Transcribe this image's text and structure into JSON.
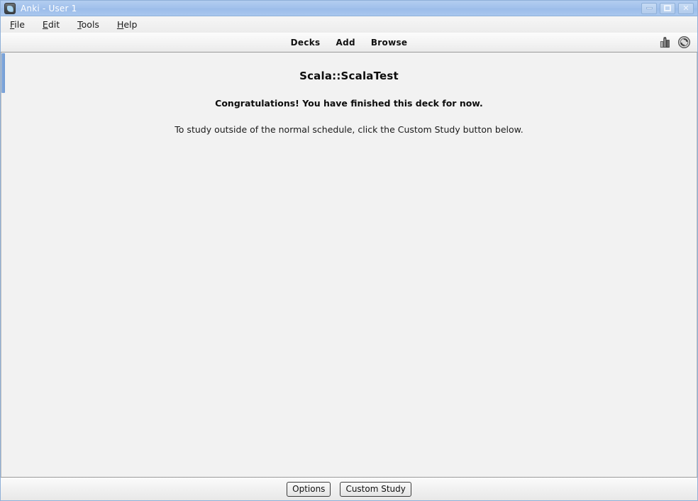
{
  "window": {
    "title": "Anki - User 1",
    "icon": "anki-app-icon",
    "controls": [
      {
        "name": "minimize",
        "glyph": "minimize-icon"
      },
      {
        "name": "maximize",
        "glyph": "maximize-icon"
      },
      {
        "name": "close",
        "glyph": "close-icon",
        "label": "✕"
      }
    ]
  },
  "menubar": {
    "items": [
      {
        "mnemonic": "F",
        "rest": "ile"
      },
      {
        "mnemonic": "E",
        "rest": "dit"
      },
      {
        "mnemonic": "T",
        "rest": "ools"
      },
      {
        "mnemonic": "H",
        "rest": "elp"
      }
    ]
  },
  "toolbar": {
    "links": [
      {
        "label": "Decks",
        "name": "decks"
      },
      {
        "label": "Add",
        "name": "add"
      },
      {
        "label": "Browse",
        "name": "browse"
      }
    ],
    "icons": [
      {
        "name": "stats-bar-chart-icon"
      },
      {
        "name": "sync-icon"
      }
    ]
  },
  "content": {
    "deck_title": "Scala::ScalaTest",
    "congrats": "Congratulations! You have finished this deck for now.",
    "hint": "To study outside of the normal schedule, click the Custom Study button below."
  },
  "bottom_bar": {
    "buttons": [
      {
        "label": "Options",
        "name": "options"
      },
      {
        "label": "Custom Study",
        "name": "custom-study"
      }
    ]
  },
  "colors": {
    "titlebar": "#a3c2ec",
    "scrollbar_thumb": "#7ba3d8",
    "content_bg": "#f2f2f2",
    "toolbar_border": "#9b9b9b"
  }
}
